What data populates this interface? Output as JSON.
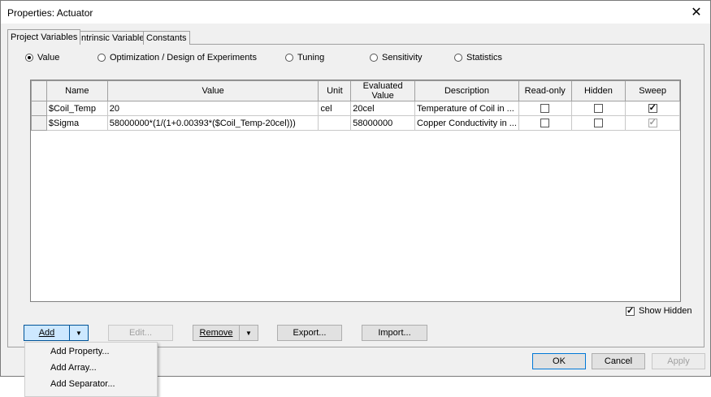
{
  "window": {
    "title": "Properties: Actuator",
    "close_glyph": "✕"
  },
  "tabs": [
    {
      "label": "Project Variables",
      "active": true
    },
    {
      "label": "Intrinsic Variables",
      "active": false
    },
    {
      "label": "Constants",
      "active": false
    }
  ],
  "modes": [
    {
      "label": "Value",
      "selected": true
    },
    {
      "label": "Optimization / Design of Experiments",
      "selected": false
    },
    {
      "label": "Tuning",
      "selected": false
    },
    {
      "label": "Sensitivity",
      "selected": false
    },
    {
      "label": "Statistics",
      "selected": false
    }
  ],
  "table": {
    "columns": [
      "Name",
      "Value",
      "Unit",
      "Evaluated Value",
      "Description",
      "Read-only",
      "Hidden",
      "Sweep"
    ],
    "rows": [
      {
        "name": "$Coil_Temp",
        "value": "20",
        "unit": "cel",
        "evaluated": "20cel",
        "description": "Temperature of Coil in ...",
        "readonly": false,
        "hidden": false,
        "sweep": true,
        "sweep_disabled": false
      },
      {
        "name": "$Sigma",
        "value": "58000000*(1/(1+0.00393*($Coil_Temp-20cel)))",
        "unit": "",
        "evaluated": "58000000",
        "description": "Copper Conductivity in ...",
        "readonly": false,
        "hidden": false,
        "sweep": true,
        "sweep_disabled": true
      }
    ]
  },
  "show_hidden": {
    "label": "Show Hidden",
    "checked": true
  },
  "buttons": {
    "add": "Add",
    "edit": "Edit...",
    "remove": "Remove",
    "export": "Export...",
    "import": "Import...",
    "ok": "OK",
    "cancel": "Cancel",
    "apply": "Apply"
  },
  "add_menu": [
    "Add Property...",
    "Add Array...",
    "Add Separator..."
  ]
}
